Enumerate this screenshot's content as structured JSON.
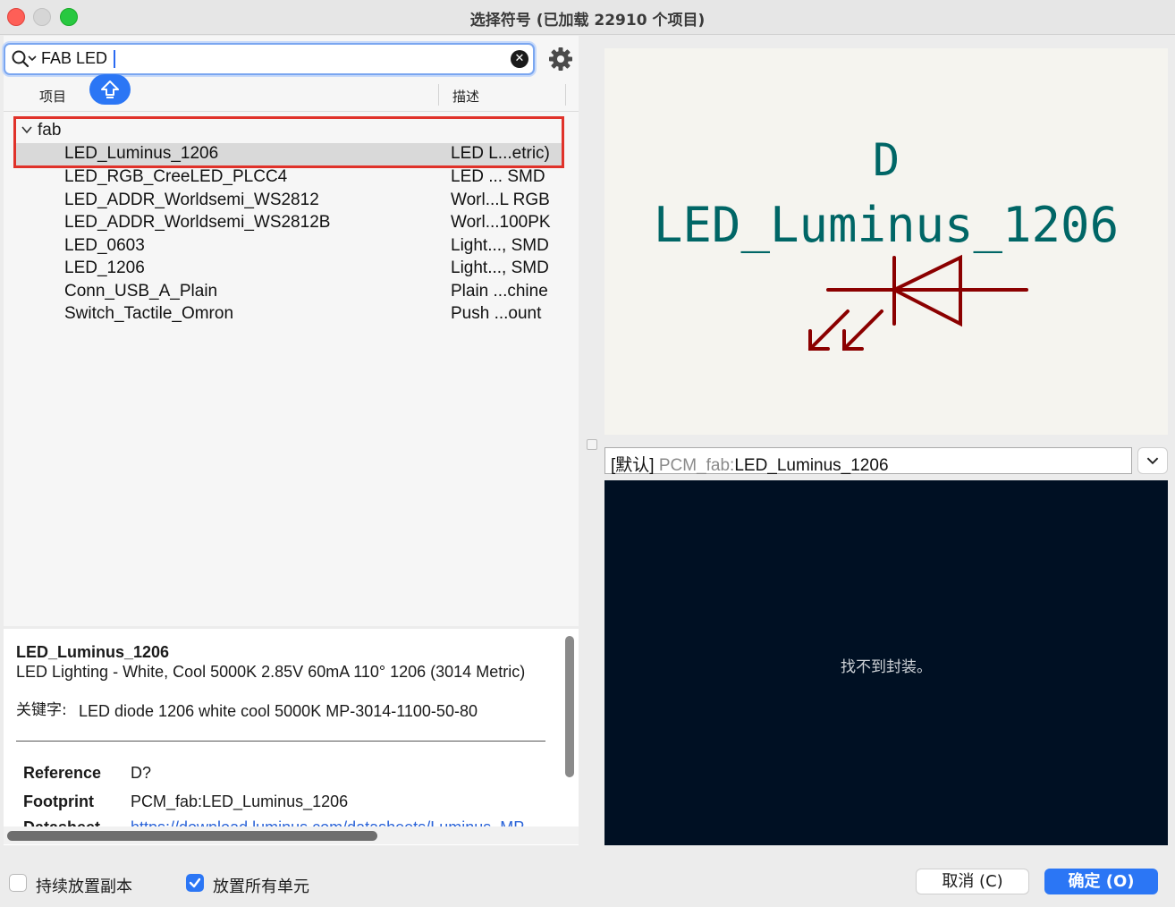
{
  "window": {
    "title": "选择符号 (已加载 22910 个项目)"
  },
  "search": {
    "value": "FAB LED"
  },
  "columns": {
    "items": "项目",
    "description": "描述"
  },
  "tree": {
    "group": "fab",
    "rows": [
      {
        "name": "LED_Luminus_1206",
        "desc": "LED L...etric)",
        "selected": true
      },
      {
        "name": "LED_RGB_CreeLED_PLCC4",
        "desc": "LED ... SMD"
      },
      {
        "name": "LED_ADDR_Worldsemi_WS2812",
        "desc": "Worl...L RGB"
      },
      {
        "name": "LED_ADDR_Worldsemi_WS2812B",
        "desc": "Worl...100PK"
      },
      {
        "name": "LED_0603",
        "desc": "Light..., SMD"
      },
      {
        "name": "LED_1206",
        "desc": "Light..., SMD"
      },
      {
        "name": "Conn_USB_A_Plain",
        "desc": "Plain ...chine"
      },
      {
        "name": "Switch_Tactile_Omron",
        "desc": "Push ...ount"
      }
    ]
  },
  "details": {
    "title": "LED_Luminus_1206",
    "description": "LED Lighting - White, Cool 5000K 2.85V 60mA 110° 1206 (3014 Metric)",
    "keywords_label": "关键字:",
    "keywords": "LED diode 1206 white cool 5000K MP-3014-1100-50-80",
    "reference_label": "Reference",
    "reference": "D?",
    "footprint_label": "Footprint",
    "footprint": "PCM_fab:LED_Luminus_1206",
    "datasheet_label": "Datasheet",
    "datasheet": "https://download.luminus.com/datasheets/Luminus_MP"
  },
  "preview": {
    "reference": "D",
    "value": "LED_Luminus_1206",
    "symbol_color": "#8b0000",
    "text_color": "#006666"
  },
  "footprint_select": {
    "tag": "[默认]",
    "lib": "PCM_fab:",
    "name": "LED_Luminus_1206"
  },
  "footprint_view": {
    "message": "找不到封装。"
  },
  "options": {
    "keep_placing": "持续放置副本",
    "keep_placing_checked": false,
    "place_all_units": "放置所有单元",
    "place_all_units_checked": true
  },
  "buttons": {
    "cancel": "取消 (C)",
    "ok": "确定 (O)"
  },
  "colors": {
    "accent": "#2b76f5",
    "highlight_box": "#e0322a"
  }
}
